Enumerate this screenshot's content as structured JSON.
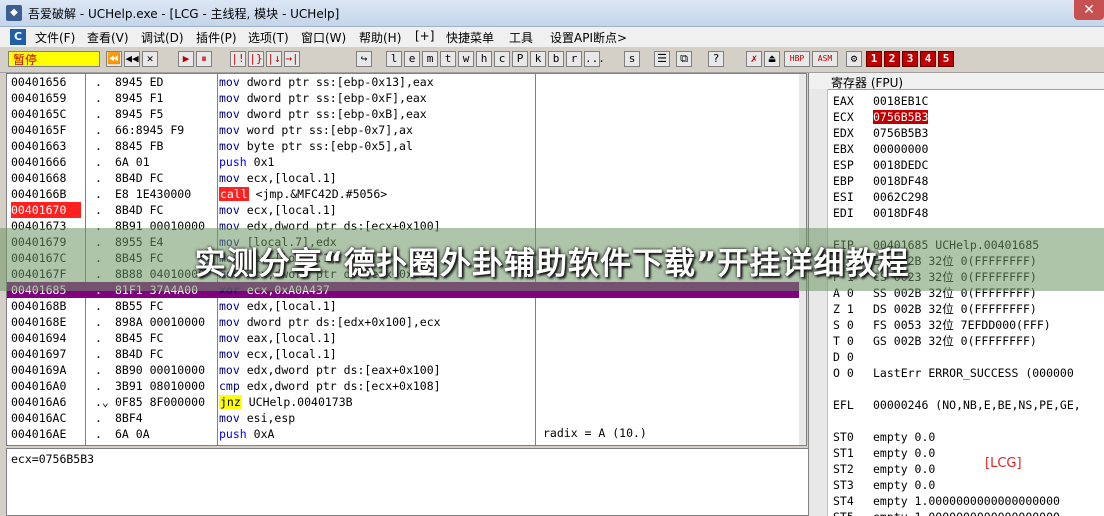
{
  "window": {
    "title": "吾爱破解 - UCHelp.exe - [LCG - 主线程, 模块 - UCHelp]",
    "close_label": "✕"
  },
  "menu": [
    "文件(F)",
    "查看(V)",
    "调试(D)",
    "插件(P)",
    "选项(T)",
    "窗口(W)",
    "帮助(H)",
    "[+]",
    "快捷菜单",
    "工具",
    "设置API断点>"
  ],
  "toolbar": {
    "status": "暂停",
    "buttons": [
      "⏪",
      "◀◀",
      "✕",
      "▶",
      "⏸",
      "|!",
      "|}",
      "|↓",
      "→|",
      "↪",
      "l",
      "e",
      "m",
      "t",
      "w",
      "h",
      "c",
      "P",
      "k",
      "b",
      "r",
      "...",
      "s"
    ],
    "right_buttons": [
      "☰",
      "⧉",
      "?",
      "✗",
      "⏏",
      "HBP",
      "ASM",
      "⚙"
    ],
    "numbers": [
      "1",
      "2",
      "3",
      "4",
      "5"
    ]
  },
  "disasm": [
    {
      "addr": "00401656",
      "dot": ".",
      "hex": "8945 ED",
      "op": "mov",
      "args": "dword ptr ss:[ebp-0x13],eax"
    },
    {
      "addr": "00401659",
      "dot": ".",
      "hex": "8945 F1",
      "op": "mov",
      "args": "dword ptr ss:[ebp-0xF],eax"
    },
    {
      "addr": "0040165C",
      "dot": ".",
      "hex": "8945 F5",
      "op": "mov",
      "args": "dword ptr ss:[ebp-0xB],eax"
    },
    {
      "addr": "0040165F",
      "dot": ".",
      "hex": "66:8945 F9",
      "op": "mov",
      "args": "word ptr ss:[ebp-0x7],ax"
    },
    {
      "addr": "00401663",
      "dot": ".",
      "hex": "8845 FB",
      "op": "mov",
      "args": "byte ptr ss:[ebp-0x5],al"
    },
    {
      "addr": "00401666",
      "dot": ".",
      "hex": "6A 01",
      "op": "push",
      "args": "0x1"
    },
    {
      "addr": "00401668",
      "dot": ".",
      "hex": "8B4D FC",
      "op": "mov",
      "args": "ecx,[local.1]"
    },
    {
      "addr": "0040166B",
      "dot": ".",
      "hex": "E8 1E430000",
      "op": "call",
      "args": "<jmp.&MFC42D.#5056>"
    },
    {
      "addr": "00401670",
      "dot": ".",
      "hex": "8B4D FC",
      "op": "mov",
      "args": "ecx,[local.1]"
    },
    {
      "addr": "00401673",
      "dot": ".",
      "hex": "8B91 00010000",
      "op": "mov",
      "args": "edx,dword ptr ds:[ecx+0x100]"
    },
    {
      "addr": "00401679",
      "dot": ".",
      "hex": "8955 E4",
      "op": "mov",
      "args": "[local.7],edx"
    },
    {
      "addr": "0040167C",
      "dot": ".",
      "hex": "8B45 FC",
      "op": "mov",
      "args": "eax,[local.1]"
    },
    {
      "addr": "0040167F",
      "dot": ".",
      "hex": "8B88 04010000",
      "op": "mov",
      "args": "ecx,dword ptr ds:[eax+0x104]"
    },
    {
      "addr": "00401685",
      "dot": ".",
      "hex": "81F1 37A4A00",
      "op": "xor",
      "args": "ecx,0xA0A437"
    },
    {
      "addr": "0040168B",
      "dot": ".",
      "hex": "8B55 FC",
      "op": "mov",
      "args": "edx,[local.1]"
    },
    {
      "addr": "0040168E",
      "dot": ".",
      "hex": "898A 00010000",
      "op": "mov",
      "args": "dword ptr ds:[edx+0x100],ecx"
    },
    {
      "addr": "00401694",
      "dot": ".",
      "hex": "8B45 FC",
      "op": "mov",
      "args": "eax,[local.1]"
    },
    {
      "addr": "00401697",
      "dot": ".",
      "hex": "8B4D FC",
      "op": "mov",
      "args": "ecx,[local.1]"
    },
    {
      "addr": "0040169A",
      "dot": ".",
      "hex": "8B90 00010000",
      "op": "mov",
      "args": "edx,dword ptr ds:[eax+0x100]"
    },
    {
      "addr": "004016A0",
      "dot": ".",
      "hex": "3B91 08010000",
      "op": "cmp",
      "args": "edx,dword ptr ds:[ecx+0x108]"
    },
    {
      "addr": "004016A6",
      "dot": ".⌄",
      "hex": "0F85 8F000000",
      "op": "jnz",
      "args": "UCHelp.0040173B"
    },
    {
      "addr": "004016AC",
      "dot": ".",
      "hex": "8BF4",
      "op": "mov",
      "args": "esi,esp"
    },
    {
      "addr": "004016AE",
      "dot": ".",
      "hex": "6A 0A",
      "op": "push",
      "args": "0xA"
    },
    {
      "addr": "004016B0",
      "dot": ".",
      "hex": "8B45 F8",
      "op": "lea",
      "args": "eax,[local.6]"
    }
  ],
  "comment": "radix = A (10.)",
  "info": "ecx=0756B5B3",
  "registers": {
    "header": "寄存器 (FPU)",
    "lines": [
      {
        "n": "EAX",
        "v": "0018EB1C",
        "hot": false
      },
      {
        "n": "ECX",
        "v": "0756B5B3",
        "hot": true
      },
      {
        "n": "EDX",
        "v": "0756B5B3",
        "hot": false
      },
      {
        "n": "EBX",
        "v": "00000000",
        "hot": false
      },
      {
        "n": "ESP",
        "v": "0018DEDC",
        "hot": false
      },
      {
        "n": "EBP",
        "v": "0018DF48",
        "hot": false
      },
      {
        "n": "ESI",
        "v": "0062C298",
        "hot": false
      },
      {
        "n": "EDI",
        "v": "0018DF48",
        "hot": false
      },
      {
        "n": "",
        "v": "",
        "hot": false
      },
      {
        "n": "EIP",
        "v": "00401685 UCHelp.00401685",
        "hot": false
      },
      {
        "n": "C 0",
        "v": "ES 002B 32位 0(FFFFFFFF)",
        "hot": false
      },
      {
        "n": "P 1",
        "v": "CS 0023 32位 0(FFFFFFFF)",
        "hot": false
      },
      {
        "n": "A 0",
        "v": "SS 002B 32位 0(FFFFFFFF)",
        "hot": false
      },
      {
        "n": "Z 1",
        "v": "DS 002B 32位 0(FFFFFFFF)",
        "hot": false
      },
      {
        "n": "S 0",
        "v": "FS 0053 32位 7EFDD000(FFF)",
        "hot": false
      },
      {
        "n": "T 0",
        "v": "GS 002B 32位 0(FFFFFFFF)",
        "hot": false
      },
      {
        "n": "D 0",
        "v": "",
        "hot": false
      },
      {
        "n": "O 0",
        "v": "LastErr ERROR_SUCCESS (000000",
        "hot": false
      },
      {
        "n": "",
        "v": "",
        "hot": false
      },
      {
        "n": "EFL",
        "v": "00000246 (NO,NB,E,BE,NS,PE,GE,",
        "hot": false
      },
      {
        "n": "",
        "v": "",
        "hot": false
      },
      {
        "n": "ST0",
        "v": "empty 0.0",
        "hot": false
      },
      {
        "n": "ST1",
        "v": "empty 0.0",
        "hot": false
      },
      {
        "n": "ST2",
        "v": "empty 0.0",
        "hot": false
      },
      {
        "n": "ST3",
        "v": "empty 0.0",
        "hot": false
      },
      {
        "n": "ST4",
        "v": "empty 1.0000000000000000000",
        "hot": false
      },
      {
        "n": "ST5",
        "v": "empty 1.0000000000000000000",
        "hot": false
      }
    ]
  },
  "watermark": "[LCG]",
  "banner": "实测分享“德扑圈外卦辅助软件下载”开挂详细教程"
}
